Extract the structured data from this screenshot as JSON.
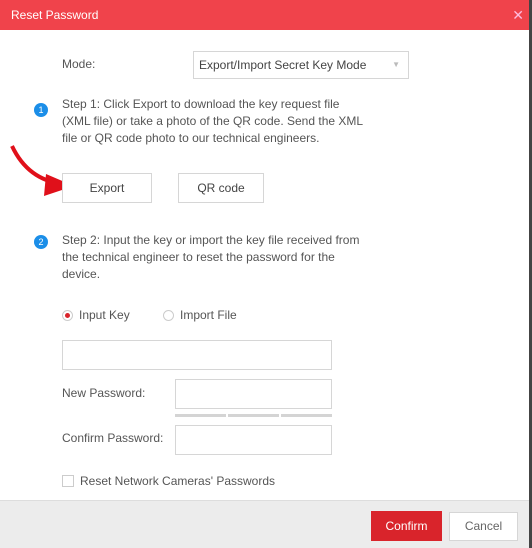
{
  "dialog": {
    "title": "Reset Password",
    "close_icon": "close-icon"
  },
  "mode": {
    "label": "Mode:",
    "value": "Export/Import Secret Key Mode"
  },
  "step1": {
    "number": "1",
    "text": "Step 1: Click Export to download the key request file (XML file) or take a photo of the QR code. Send the XML file or QR code photo to our technical engineers.",
    "export_label": "Export",
    "qr_label": "QR code"
  },
  "step2": {
    "number": "2",
    "text": "Step 2: Input the key or import the key file received from the technical engineer to reset the password for the device.",
    "radio_input_key": "Input Key",
    "radio_import_file": "Import File",
    "selected": "Input Key",
    "key_value": "",
    "new_password_label": "New Password:",
    "new_password_value": "",
    "confirm_password_label": "Confirm Password:",
    "confirm_password_value": "",
    "reset_cameras_label": "Reset Network Cameras' Passwords",
    "reset_cameras_checked": false
  },
  "footer": {
    "confirm_label": "Confirm",
    "cancel_label": "Cancel"
  },
  "colors": {
    "header": "#f0434b",
    "confirm": "#d9242b",
    "step_badge": "#1b8ee8",
    "annotation_arrow": "#e0101a"
  }
}
